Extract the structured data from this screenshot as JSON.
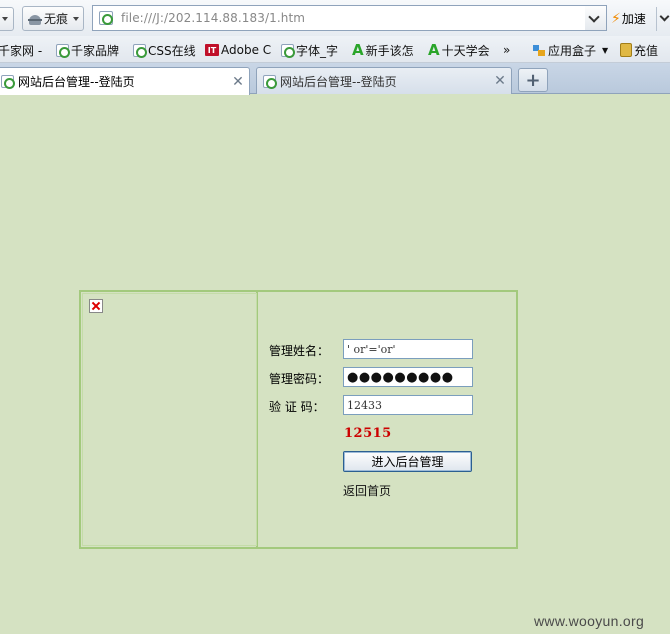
{
  "toolbar": {
    "stealth_label": "无痕",
    "url": "file:///J:/202.114.88.183/1.htm",
    "speed_label": "加速"
  },
  "favorites": [
    {
      "label": "千家网 -",
      "icon": "none"
    },
    {
      "label": "千家品牌",
      "icon": "ie-page-icon"
    },
    {
      "label": "CSS在线",
      "icon": "ie-page-icon"
    },
    {
      "label": "Adobe C",
      "icon": "it-logo-icon"
    },
    {
      "label": "字体_字",
      "icon": "ie-page-icon"
    },
    {
      "label": "新手该怎",
      "icon": "a-logo-icon"
    },
    {
      "label": "十天学会",
      "icon": "a-logo-icon"
    },
    {
      "label": "»",
      "icon": "none"
    },
    {
      "label": "应用盒子",
      "icon": "app-box-icon"
    },
    {
      "label": "充值",
      "icon": "gift-icon"
    }
  ],
  "tabs": [
    {
      "title": "网站后台管理--登陆页",
      "active": true
    },
    {
      "title": "网站后台管理--登陆页",
      "active": false
    }
  ],
  "new_tab_label": "+",
  "login": {
    "username_label": "管理姓名：",
    "username_value": "' or'='or'",
    "password_label": "管理密码：",
    "password_value": "●●●●●●●●●",
    "captcha_label": "验 证 码：",
    "captcha_value": "12433",
    "captcha_text": "12515",
    "submit_label": "进入后台管理",
    "home_link": "返回首页"
  },
  "watermark": "www.wooyun.org"
}
